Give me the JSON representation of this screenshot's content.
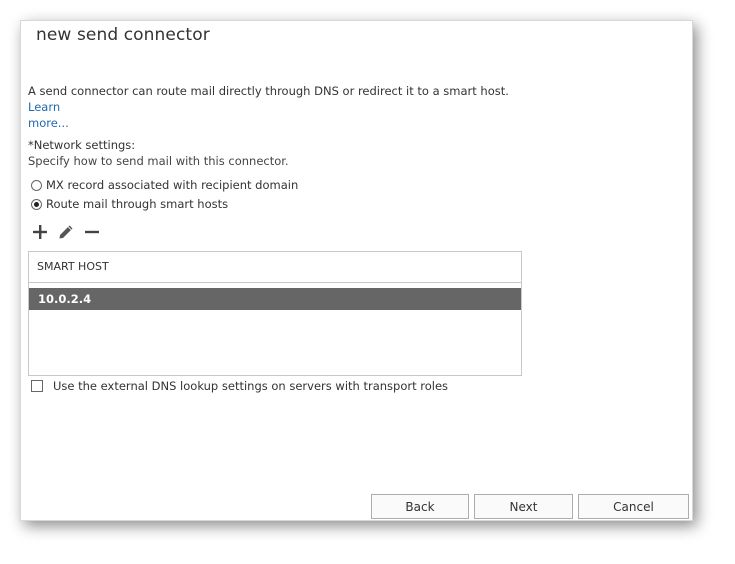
{
  "dialog": {
    "title": "new send connector",
    "description": "A send connector can route mail directly through DNS or redirect it to a smart host.",
    "learn_more_line1": "Learn",
    "learn_more_line2": "more..."
  },
  "network": {
    "label": "*Network settings:",
    "sublabel": "Specify how to send mail with this connector.",
    "options": [
      {
        "label": "MX record associated with recipient domain",
        "selected": false
      },
      {
        "label": "Route mail through smart hosts",
        "selected": true
      }
    ]
  },
  "toolbar": {
    "icons": [
      "plus-icon",
      "pencil-icon",
      "minus-icon"
    ]
  },
  "smart_hosts_table": {
    "header": "SMART HOST",
    "rows": [
      {
        "value": "10.0.2.4",
        "selected": true
      }
    ]
  },
  "dns_lookup": {
    "label": "Use the external DNS lookup settings on servers with transport roles",
    "checked": false
  },
  "buttons": {
    "back": "Back",
    "next": "Next",
    "cancel": "Cancel"
  },
  "colors": {
    "link": "#1e6ab1",
    "selected_row_bg": "#666666",
    "selected_row_text": "#ffffff"
  }
}
